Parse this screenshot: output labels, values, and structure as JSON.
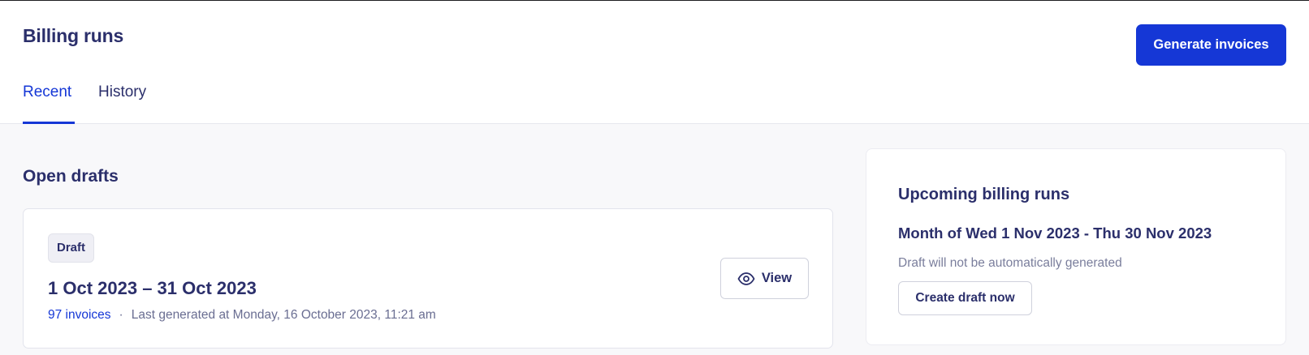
{
  "header": {
    "title": "Billing runs",
    "generate_button": "Generate invoices",
    "tabs": [
      {
        "label": "Recent",
        "active": true
      },
      {
        "label": "History",
        "active": false
      }
    ]
  },
  "open_drafts": {
    "title": "Open drafts",
    "cards": [
      {
        "badge": "Draft",
        "date_range": "1 Oct 2023 – 31 Oct 2023",
        "invoices": "97 invoices",
        "separator": "·",
        "last_generated": "Last generated at Monday, 16 October 2023, 11:21 am",
        "view_button": "View",
        "view_icon": "eye-icon"
      }
    ]
  },
  "upcoming": {
    "title": "Upcoming billing runs",
    "month": "Month of Wed 1 Nov 2023 - Thu 30 Nov 2023",
    "note": "Draft will not be automatically generated",
    "create_button": "Create draft now"
  },
  "colors": {
    "accent": "#1537d6",
    "text": "#2b2f6b",
    "muted": "#6a6e92",
    "background": "#f8f8fa"
  }
}
